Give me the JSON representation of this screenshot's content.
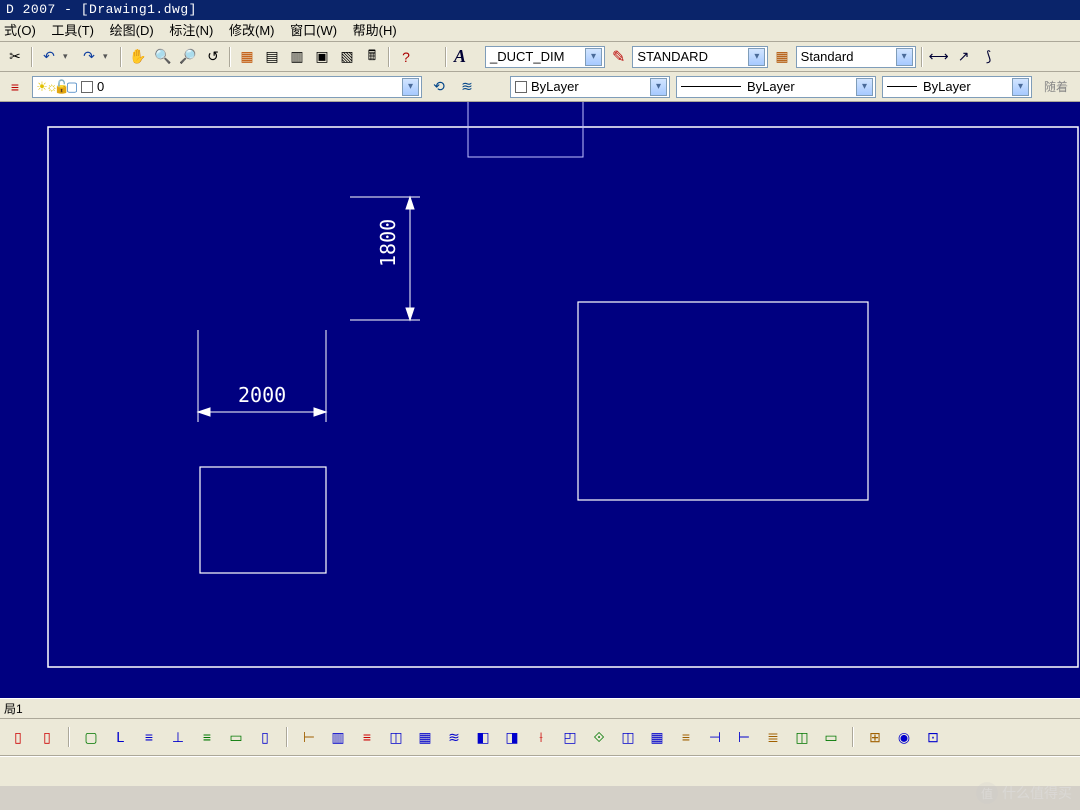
{
  "title": "D 2007 - [Drawing1.dwg]",
  "menu": {
    "m0": "式(O)",
    "m1": "工具(T)",
    "m2": "绘图(D)",
    "m3": "标注(N)",
    "m4": "修改(M)",
    "m5": "窗口(W)",
    "m6": "帮助(H)"
  },
  "styles": {
    "dimstyle": "_DUCT_DIM",
    "textstyle": "STANDARD",
    "tablestyle": "Standard"
  },
  "layer": {
    "current": "0"
  },
  "props": {
    "color": "ByLayer",
    "linetype": "ByLayer",
    "lineweight": "ByLayer",
    "other": "随着"
  },
  "drawing": {
    "dim_vert": "1800",
    "dim_horiz": "2000"
  },
  "status": {
    "tab": "局1"
  },
  "watermark": {
    "char": "值",
    "text": "什么值得买"
  }
}
